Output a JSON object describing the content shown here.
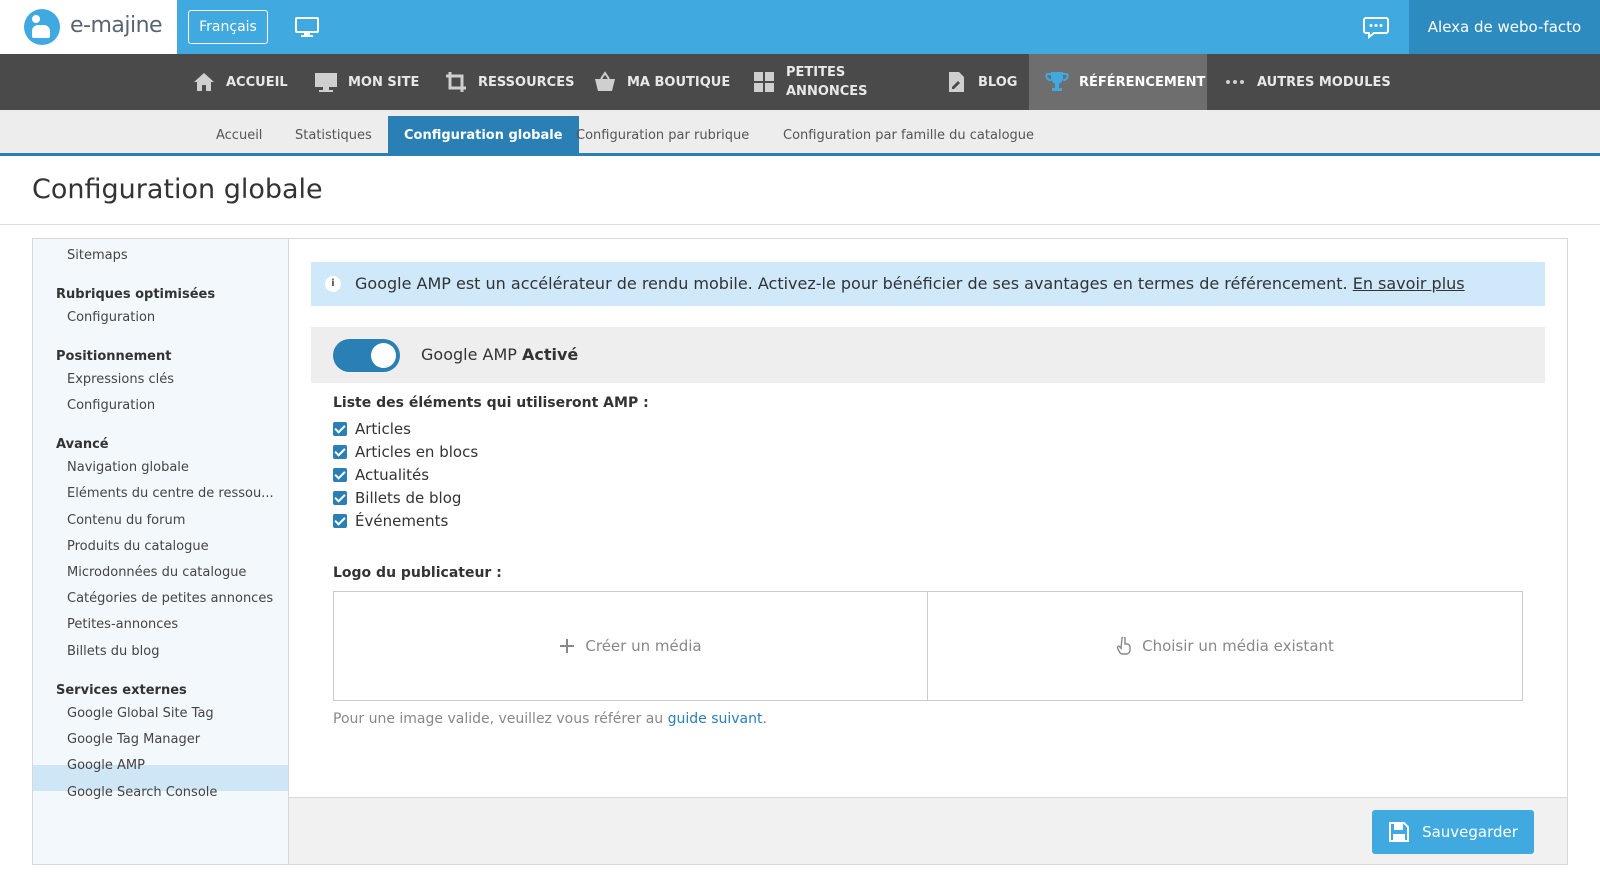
{
  "header": {
    "logo_text": "e-majine",
    "language_button": "Français",
    "user_name": "Alexa de webo-facto"
  },
  "main_nav": {
    "items": [
      {
        "label": "ACCUEIL",
        "icon": "home-icon"
      },
      {
        "label": "MON SITE",
        "icon": "monitor-icon"
      },
      {
        "label": "RESSOURCES",
        "icon": "crop-icon"
      },
      {
        "label": "MA BOUTIQUE",
        "icon": "basket-icon"
      },
      {
        "label_line1": "PETITES",
        "label_line2": "ANNONCES",
        "icon": "grid-icon"
      },
      {
        "label": "BLOG",
        "icon": "document-edit-icon"
      },
      {
        "label": "RÉFÉRENCEMENT",
        "icon": "trophy-icon",
        "active": true
      },
      {
        "label": "AUTRES MODULES",
        "icon": "dots-icon"
      }
    ]
  },
  "sub_nav": {
    "items": [
      {
        "label": "Accueil"
      },
      {
        "label": "Statistiques"
      },
      {
        "label": "Configuration globale",
        "active": true
      },
      {
        "label": "Configuration par rubrique"
      },
      {
        "label": "Configuration par famille du catalogue"
      }
    ]
  },
  "page": {
    "title": "Configuration globale"
  },
  "sidebar": {
    "items": [
      {
        "type": "link",
        "label": "Sitemaps"
      },
      {
        "type": "heading",
        "label": "Rubriques optimisées"
      },
      {
        "type": "link",
        "label": "Configuration"
      },
      {
        "type": "heading",
        "label": "Positionnement"
      },
      {
        "type": "link",
        "label": "Expressions clés"
      },
      {
        "type": "link",
        "label": "Configuration"
      },
      {
        "type": "heading",
        "label": "Avancé"
      },
      {
        "type": "link",
        "label": "Navigation globale"
      },
      {
        "type": "link",
        "label": "Eléments du centre de ressou..."
      },
      {
        "type": "link",
        "label": "Contenu du forum"
      },
      {
        "type": "link",
        "label": "Produits du catalogue"
      },
      {
        "type": "link",
        "label": "Microdonnées du catalogue"
      },
      {
        "type": "link",
        "label": "Catégories de petites annonces"
      },
      {
        "type": "link",
        "label": "Petites-annonces"
      },
      {
        "type": "link",
        "label": "Billets du blog"
      },
      {
        "type": "heading",
        "label": "Services externes"
      },
      {
        "type": "link",
        "label": "Google Global Site Tag"
      },
      {
        "type": "link",
        "label": "Google Tag Manager"
      },
      {
        "type": "link",
        "label": "Google AMP",
        "selected": true
      },
      {
        "type": "link",
        "label": "Google Search Console"
      }
    ]
  },
  "content": {
    "info_text": "Google AMP est un accélérateur de rendu mobile. Activez-le pour bénéficier de ses avantages en termes de référencement.",
    "info_link": "En savoir plus",
    "toggle": {
      "label": "Google AMP",
      "state_label": "Activé",
      "on": true
    },
    "list_title": "Liste des éléments qui utiliseront AMP :",
    "checkboxes": [
      {
        "label": "Articles",
        "checked": true
      },
      {
        "label": "Articles en blocs",
        "checked": true
      },
      {
        "label": "Actualités",
        "checked": true
      },
      {
        "label": "Billets de blog",
        "checked": true
      },
      {
        "label": "Événements",
        "checked": true
      }
    ],
    "logo_title": "Logo du publicateur :",
    "media_create": "Créer un média",
    "media_choose": "Choisir un média existant",
    "note_text": "Pour une image valide, veuillez vous référer au",
    "note_link": "guide suivant",
    "note_end": ".",
    "save_button": "Sauvegarder"
  },
  "colors": {
    "brand_blue": "#3fa9e0",
    "active_blue": "#2a7fb4",
    "nav_dark": "#4a4a4a",
    "info_bg": "#cfe8fa"
  }
}
